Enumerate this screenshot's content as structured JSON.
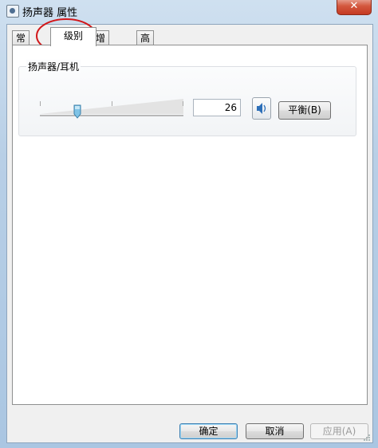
{
  "window": {
    "title": "扬声器 属性",
    "close": "✕"
  },
  "tabs": [
    {
      "label": "常规"
    },
    {
      "label": "级别"
    },
    {
      "label": "增强功能"
    },
    {
      "label": "高级"
    }
  ],
  "levels": {
    "device_label": "扬声器/耳机",
    "volume_value": "26",
    "volume_level_percent": 26,
    "balance_label": "平衡(B)"
  },
  "buttons": {
    "ok": "确定",
    "cancel": "取消",
    "apply": "应用(A)"
  },
  "colors": {
    "annotation_red": "#d2171a",
    "close_red": "#c43a22"
  },
  "icons": {
    "speaker": "speaker-icon",
    "app": "app-icon"
  }
}
